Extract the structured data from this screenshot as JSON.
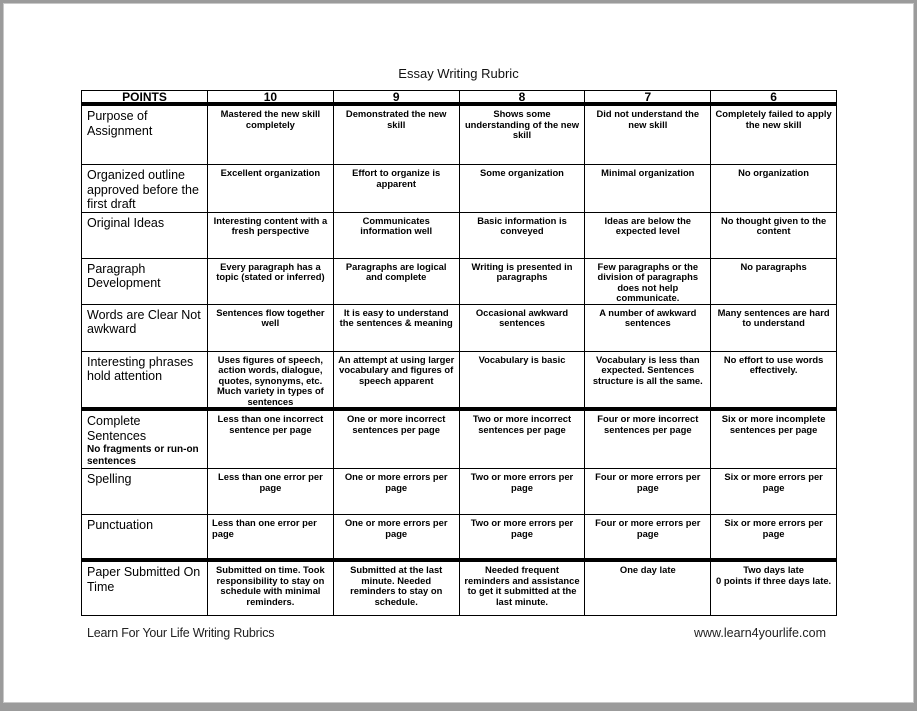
{
  "document": {
    "title": "Essay Writing Rubric",
    "footer_left": "Learn For Your Life Writing Rubrics",
    "footer_right": "www.learn4yourlife.com"
  },
  "table": {
    "headers": [
      "POINTS",
      "10",
      "9",
      "8",
      "7",
      "6"
    ],
    "rows": [
      {
        "criterion": "Purpose of Assignment",
        "sub": "",
        "cells": [
          "Mastered the new skill completely",
          "Demonstrated the new skill",
          "Shows some understanding of the new skill",
          "Did not understand the new skill",
          "Completely failed to apply the new skill"
        ]
      },
      {
        "criterion": "Organized outline approved before the first draft",
        "sub": "",
        "cells": [
          "Excellent organization",
          "Effort to organize is apparent",
          "Some organization",
          "Minimal organization",
          "No organization"
        ]
      },
      {
        "criterion": "Original Ideas",
        "sub": "",
        "cells": [
          "Interesting content with a fresh perspective",
          "Communicates information well",
          "Basic information is conveyed",
          "Ideas are below the expected level",
          "No thought given to the content"
        ]
      },
      {
        "criterion": "Paragraph Development",
        "sub": "",
        "cells": [
          "Every paragraph has a topic (stated or inferred)",
          "Paragraphs are logical and complete",
          "Writing is presented in paragraphs",
          "Few paragraphs or the division of paragraphs does not help communicate.",
          "No paragraphs"
        ]
      },
      {
        "criterion": "Words are Clear Not awkward",
        "sub": "",
        "cells": [
          "Sentences flow together well",
          "It is easy to understand the sentences & meaning",
          "Occasional awkward sentences",
          "A number of awkward sentences",
          "Many sentences are hard to understand"
        ]
      },
      {
        "criterion": "Interesting phrases hold attention",
        "sub": "",
        "cells": [
          "Uses figures of speech, action words, dialogue, quotes, synonyms, etc. Much variety in types of sentences",
          "An attempt at using larger vocabulary and figures of speech apparent",
          "Vocabulary is basic",
          "Vocabulary is less than expected.  Sentences structure is all the same.",
          "No effort to use words effectively."
        ]
      },
      {
        "criterion": "Complete Sentences",
        "sub": "No fragments or run-on sentences",
        "cells": [
          "Less than one incorrect sentence per page",
          "One or more incorrect sentences per page",
          "Two or more incorrect sentences per page",
          "Four or more incorrect sentences per page",
          "Six or more incomplete sentences per page"
        ]
      },
      {
        "criterion": "Spelling",
        "sub": "",
        "cells": [
          "Less than one error per page",
          "One or more errors per page",
          "Two or more errors per page",
          "Four or more errors per page",
          "Six or more errors per page"
        ]
      },
      {
        "criterion": "Punctuation",
        "sub": "",
        "cells": [
          "Less than one  error per page",
          "One or more errors per page",
          "Two or more errors per page",
          "Four or more errors per page",
          "Six or more errors per page"
        ]
      },
      {
        "criterion": "Paper Submitted On Time",
        "sub": "",
        "cells": [
          "Submitted on time. Took responsibility to stay on schedule with minimal reminders.",
          "Submitted at the last minute.  Needed reminders to stay on schedule.",
          "Needed frequent reminders and assistance to get it submitted at the last minute.",
          "One day late",
          "Two days late\n0 points if three days late."
        ]
      }
    ]
  }
}
